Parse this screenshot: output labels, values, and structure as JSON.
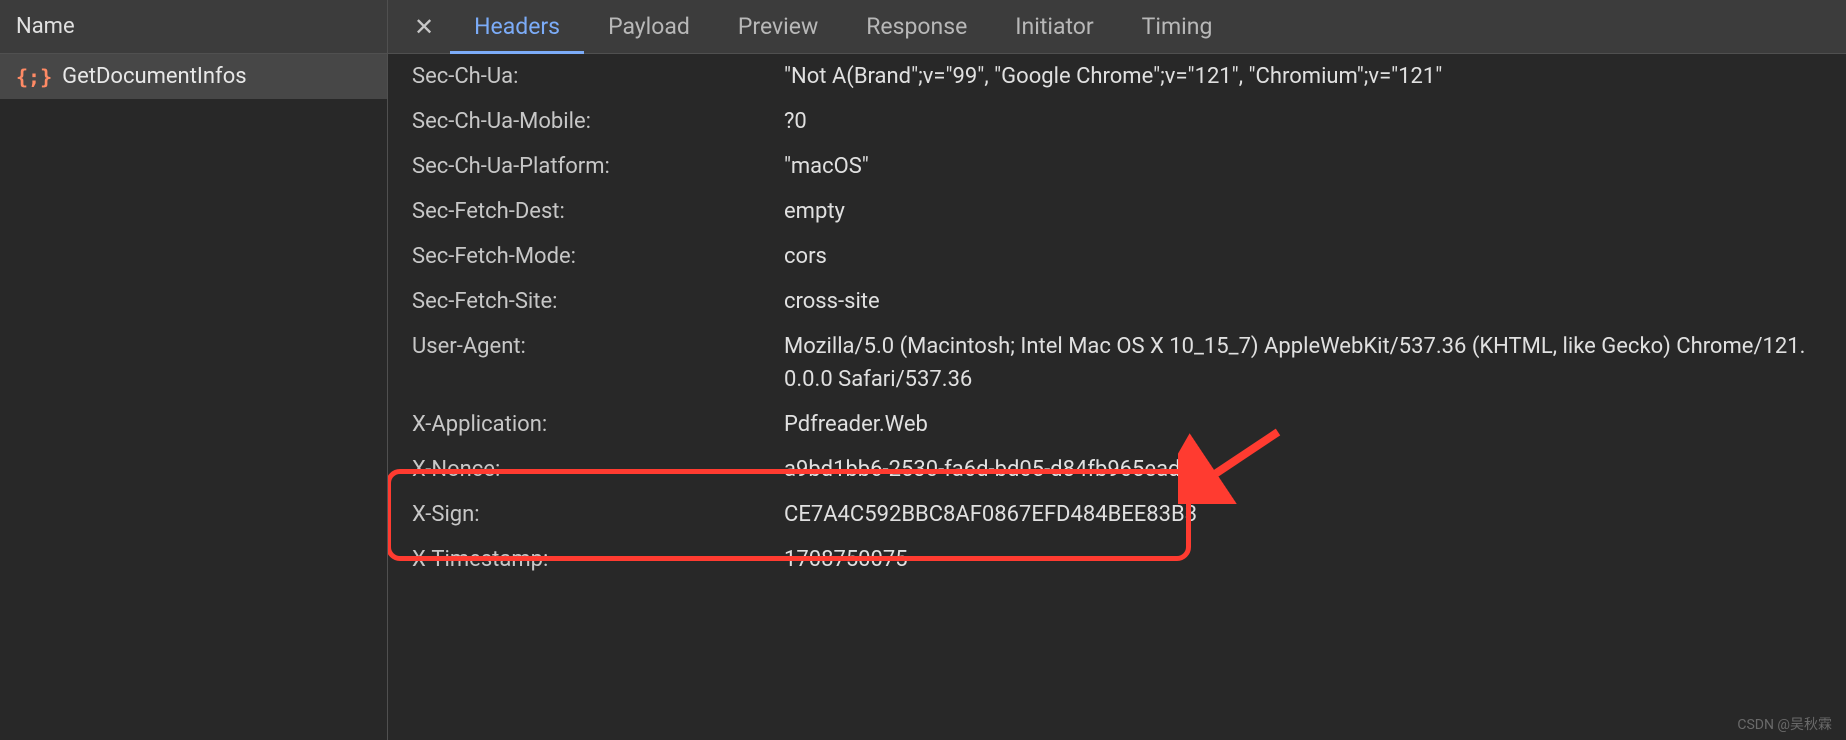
{
  "sidebarHeader": "Name",
  "request": {
    "iconText": "{;}",
    "name": "GetDocumentInfos"
  },
  "tabs": [
    {
      "label": "Headers",
      "active": true
    },
    {
      "label": "Payload",
      "active": false
    },
    {
      "label": "Preview",
      "active": false
    },
    {
      "label": "Response",
      "active": false
    },
    {
      "label": "Initiator",
      "active": false
    },
    {
      "label": "Timing",
      "active": false
    }
  ],
  "closeIcon": "✕",
  "headers": [
    {
      "name": "Sec-Ch-Ua:",
      "value": "\"Not A(Brand\";v=\"99\", \"Google Chrome\";v=\"121\", \"Chromium\";v=\"121\""
    },
    {
      "name": "Sec-Ch-Ua-Mobile:",
      "value": "?0"
    },
    {
      "name": "Sec-Ch-Ua-Platform:",
      "value": "\"macOS\""
    },
    {
      "name": "Sec-Fetch-Dest:",
      "value": "empty"
    },
    {
      "name": "Sec-Fetch-Mode:",
      "value": "cors"
    },
    {
      "name": "Sec-Fetch-Site:",
      "value": "cross-site"
    },
    {
      "name": "User-Agent:",
      "value": "Mozilla/5.0 (Macintosh; Intel Mac OS X 10_15_7) AppleWebKit/537.36 (KHTML, like Gecko) Chrome/121.0.0.0 Safari/537.36"
    },
    {
      "name": "X-Application:",
      "value": "Pdfreader.Web"
    },
    {
      "name": "X-Nonce:",
      "value": "a9bd1bb6-2530-fa6d-bd05-d84fb965eade"
    },
    {
      "name": "X-Sign:",
      "value": "CE7A4C592BBC8AF0867EFD484BEE83B3"
    },
    {
      "name": "X-Timestamp:",
      "value": "1708750075"
    }
  ],
  "watermark": "CSDN @吴秋霖"
}
